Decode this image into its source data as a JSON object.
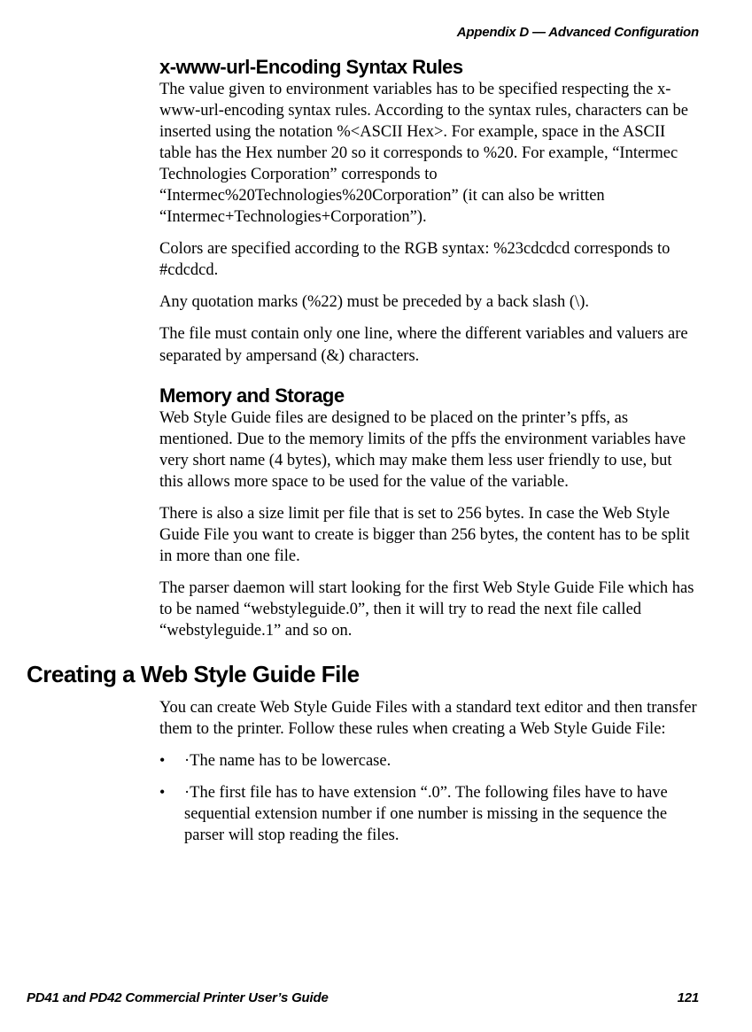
{
  "header": {
    "appendix": "Appendix D — Advanced Configuration"
  },
  "sections": {
    "encoding": {
      "heading": "x-www-url-Encoding Syntax Rules",
      "p1": "The value given to environment variables has to be specified respecting the x-www-url-encoding syntax rules. According to the syntax rules, characters can be inserted using the notation %<ASCII Hex>. For example, space in the ASCII table has the Hex number 20 so it corresponds to %20. For example, “Intermec Technologies Corporation” corresponds to “Intermec%20Technologies%20Corporation” (it can also be written “Intermec+Technologies+Corporation”).",
      "p2": "Colors are specified according to the RGB syntax: %23cdcdcd corresponds to #cdcdcd.",
      "p3": "Any quotation marks (%22) must be preceded by a back slash (\\).",
      "p4": "The file must contain only one line, where the different variables and valuers are separated by ampersand (&) characters."
    },
    "memory": {
      "heading": "Memory and Storage",
      "p1": "Web Style Guide files are designed to be placed on the printer’s pffs, as mentioned. Due to the memory limits of the pffs the environment variables have very short name (4 bytes), which may make them less user friendly to use, but this allows more space to be used for the value of the variable.",
      "p2": "There is also a size limit per file that is set to 256 bytes. In case the Web Style Guide File you want to create is bigger than 256 bytes, the content has to be split in more than one file.",
      "p3": "The parser daemon will start looking for the first Web Style Guide File which has to be named “webstyleguide.0”, then it will try to read the next file called “webstyleguide.1” and so on."
    },
    "creating": {
      "heading": "Creating a Web Style Guide File",
      "p1": "You can create Web Style Guide Files with a standard text editor and then transfer them to the printer. Follow these rules when creating a Web Style Guide File:",
      "bullets": {
        "b1": "·The name has to be lowercase.",
        "b2": "·The first file has to have extension “.0”. The following files have to have sequential extension number if one number is missing in the sequence the parser will stop reading the files."
      }
    }
  },
  "footer": {
    "title": "PD41 and PD42 Commercial Printer User’s Guide",
    "page": "121"
  }
}
